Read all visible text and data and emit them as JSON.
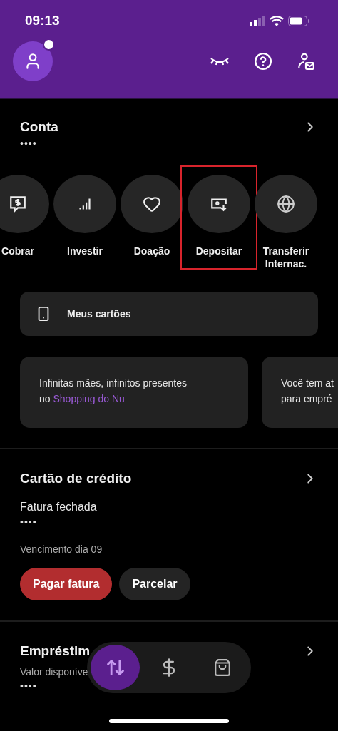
{
  "status_bar": {
    "time": "09:13"
  },
  "header": {
    "avatar": {
      "notification": true
    }
  },
  "account": {
    "title": "Conta",
    "balance": "••••"
  },
  "actions": [
    {
      "kind": "charge",
      "label": "Cobrar",
      "highlighted": false
    },
    {
      "kind": "invest",
      "label": "Investir",
      "highlighted": false
    },
    {
      "kind": "donate",
      "label": "Doação",
      "highlighted": false
    },
    {
      "kind": "deposit",
      "label": "Depositar",
      "highlighted": true
    },
    {
      "kind": "international",
      "label": "Transferir Internac.",
      "highlighted": false
    }
  ],
  "cards_button": {
    "label": "Meus cartões"
  },
  "promos": [
    {
      "lines": [
        "Infinitas mães, infinitos presentes",
        "no **Shopping do Nu**"
      ]
    },
    {
      "lines": [
        "Você tem at",
        "para empré"
      ]
    }
  ],
  "credit_card": {
    "title": "Cartão de crédito",
    "status": "Fatura fechada",
    "amount": "••••",
    "due": "Vencimento dia 09",
    "buttons": [
      {
        "kind": "primary",
        "label": "Pagar fatura"
      },
      {
        "kind": "secondary",
        "label": "Parcelar"
      }
    ]
  },
  "loan": {
    "title": "Empréstim",
    "subtitle": "Valor disponíve",
    "amount": "••••"
  },
  "bottom_nav": [
    {
      "kind": "transfer",
      "selected": true
    },
    {
      "kind": "money",
      "selected": false
    },
    {
      "kind": "shopping",
      "selected": false
    }
  ]
}
